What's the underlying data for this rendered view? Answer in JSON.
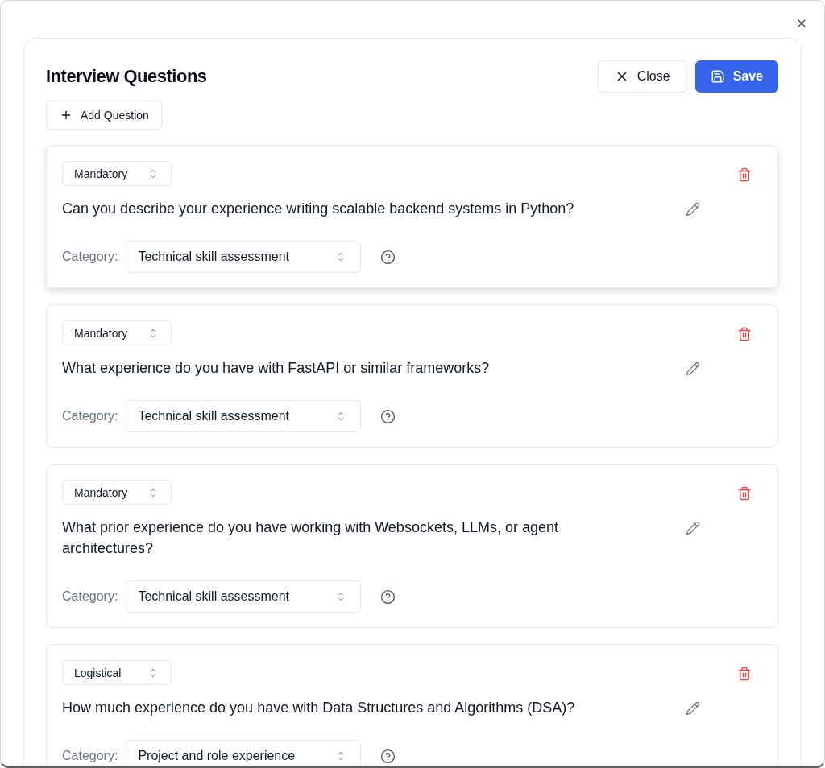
{
  "dialog": {
    "title": "Interview Questions",
    "close_button": "Close",
    "save_button": "Save",
    "add_button": "Add Question"
  },
  "questions": [
    {
      "priority": "Mandatory",
      "text": "Can you describe your experience writing scalable backend systems in Python?",
      "category_label": "Category:",
      "category": "Technical skill assessment",
      "hovered": true
    },
    {
      "priority": "Mandatory",
      "text": "What experience do you have with FastAPI or similar frameworks?",
      "category_label": "Category:",
      "category": "Technical skill assessment",
      "hovered": false
    },
    {
      "priority": "Mandatory",
      "text": "What prior experience do you have working with Websockets, LLMs, or agent architectures?",
      "category_label": "Category:",
      "category": "Technical skill assessment",
      "hovered": false
    },
    {
      "priority": "Logistical",
      "text": "How much experience do you have with Data Structures and Algorithms (DSA)?",
      "category_label": "Category:",
      "category": "Project and role experience",
      "hovered": false
    }
  ]
}
